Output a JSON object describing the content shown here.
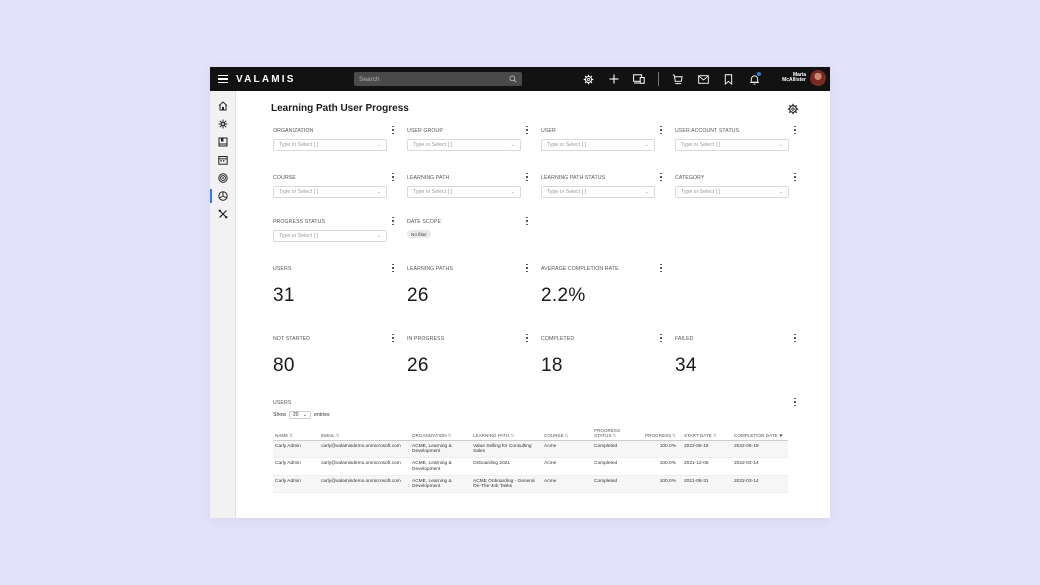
{
  "topbar": {
    "brand": "VALAMIS",
    "search_placeholder": "Search",
    "icons": [
      "settings-icon",
      "plus-icon",
      "devices-icon",
      "cart-icon",
      "mail-icon",
      "bookmark-icon",
      "bell-icon"
    ],
    "user_first": "Maria",
    "user_last": "McAllister"
  },
  "sidebar": {
    "items": [
      "home-icon",
      "network-icon",
      "book-icon",
      "calendar-icon",
      "target-icon",
      "analytics-icon",
      "tools-icon"
    ],
    "active": "analytics-icon"
  },
  "page": {
    "title": "Learning Path User Progress"
  },
  "filters": [
    {
      "label": "ORGANIZATION",
      "placeholder": "Type or Select [ ]"
    },
    {
      "label": "USER GROUP",
      "placeholder": "Type or Select [ ]"
    },
    {
      "label": "USER",
      "placeholder": "Type or Select [ ]"
    },
    {
      "label": "USER ACCOUNT STATUS",
      "placeholder": "Type or Select [ ]"
    },
    {
      "label": "COURSE",
      "placeholder": "Type or Select [ ]"
    },
    {
      "label": "LEARNING PATH",
      "placeholder": "Type or Select [ ]"
    },
    {
      "label": "LEARNING PATH STATUS",
      "placeholder": "Type or Select [ ]"
    },
    {
      "label": "CATEGORY",
      "placeholder": "Type or Select [ ]"
    },
    {
      "label": "PROGRESS STATUS",
      "placeholder": "Type or Select [ ]"
    }
  ],
  "date_scope": {
    "label": "DATE SCOPE",
    "value": "No filter"
  },
  "stats_row1": [
    {
      "label": "USERS",
      "value": "31"
    },
    {
      "label": "LEARNING PATHS",
      "value": "26"
    },
    {
      "label": "AVERAGE COMPLETION RATE",
      "value": "2.2%"
    }
  ],
  "stats_row2": [
    {
      "label": "NOT STARTED",
      "value": "80"
    },
    {
      "label": "IN PROGRESS",
      "value": "26"
    },
    {
      "label": "COMPLETED",
      "value": "18"
    },
    {
      "label": "FAILED",
      "value": "34"
    }
  ],
  "users_table": {
    "title": "USERS",
    "show_label": "Show",
    "entries_value": "20",
    "entries_label": "entries",
    "columns": [
      "NAME",
      "EMAIL",
      "ORGANIZATION",
      "LEARNING PATH",
      "COURSE",
      "PROGRESS STATUS",
      "PROGRESS",
      "START DATE",
      "COMPLETION DATE"
    ],
    "rows": [
      [
        "Carly Admin",
        "carly@valamisdemo.onmicrosoft.com",
        "ACME, Learning & Development",
        "Value Selling for Consulting Sales",
        "Acme",
        "Completed",
        "100.0%",
        "2022-05-18",
        "2022-05-18"
      ],
      [
        "Carly Admin",
        "carly@valamisdemo.onmicrosoft.com",
        "ACME, Learning & Development",
        "Onboarding 2021",
        "Acme",
        "Completed",
        "100.0%",
        "2021-12-06",
        "2022-03-14"
      ],
      [
        "Carly Admin",
        "carly@valamisdemo.onmicrosoft.com",
        "ACME, Learning & Development",
        "ACME Onboarding - General On-The-Job Tasks",
        "Acme",
        "Completed",
        "100.0%",
        "2021-08-31",
        "2022-03-14"
      ]
    ]
  }
}
